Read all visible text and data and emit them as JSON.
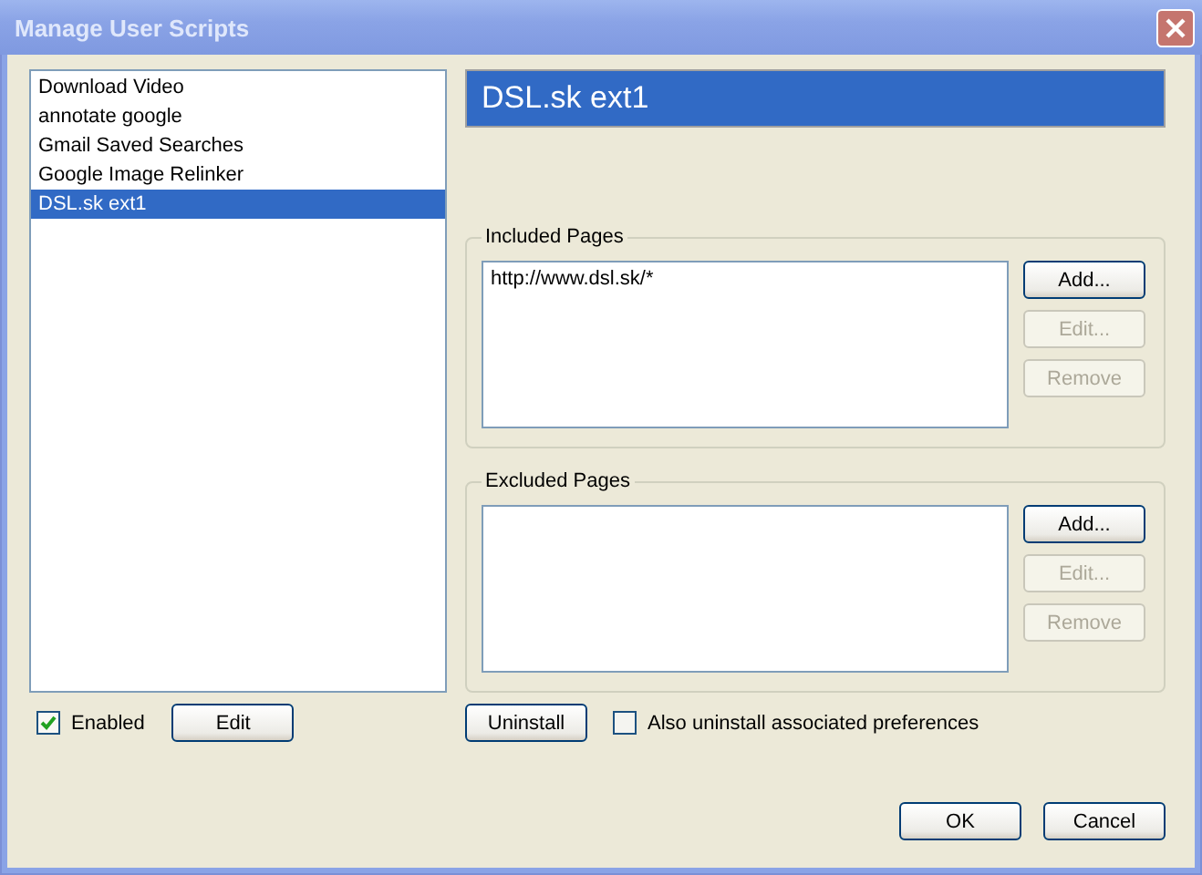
{
  "window": {
    "title": "Manage User Scripts"
  },
  "scripts": [
    {
      "name": "Download Video",
      "selected": false
    },
    {
      "name": "annotate google",
      "selected": false
    },
    {
      "name": "Gmail Saved Searches",
      "selected": false
    },
    {
      "name": "Google Image Relinker",
      "selected": false
    },
    {
      "name": "DSL.sk ext1",
      "selected": true
    }
  ],
  "enabled": {
    "label": "Enabled",
    "checked": true
  },
  "edit_button": "Edit",
  "script_title": "DSL.sk ext1",
  "groups": [
    {
      "label": "Included Pages",
      "pages": [
        "http://www.dsl.sk/*"
      ],
      "buttons": [
        {
          "label": "Add...",
          "disabled": false
        },
        {
          "label": "Edit...",
          "disabled": true
        },
        {
          "label": "Remove",
          "disabled": true
        }
      ]
    },
    {
      "label": "Excluded Pages",
      "buttons": [
        {
          "label": "Add...",
          "disabled": false
        },
        {
          "label": "Edit...",
          "disabled": true
        },
        {
          "label": "Remove",
          "disabled": true
        }
      ]
    }
  ],
  "uninstall_button": "Uninstall",
  "uninstall_prefs": {
    "label": "Also uninstall associated preferences",
    "checked": false
  },
  "dialog_buttons": [
    "OK",
    "Cancel"
  ]
}
